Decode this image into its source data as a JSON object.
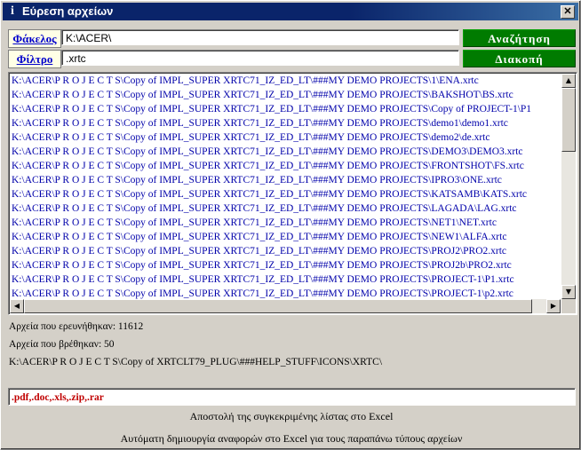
{
  "window": {
    "title": "Εύρεση αρχείων",
    "title_icon": "info-icon",
    "close_glyph": "✕"
  },
  "folder": {
    "label": "Φάκελος",
    "value": "K:\\ACER\\"
  },
  "filter": {
    "label": "Φίλτρο",
    "value": ".xrtc"
  },
  "buttons": {
    "search": "Αναζήτηση",
    "stop": "Διακοπή"
  },
  "results": [
    "K:\\ACER\\P R O J E C T S\\Copy of IMPL_SUPER XRTC71_IZ_ED_LT\\###MY DEMO PROJECTS\\1\\ENA.xrtc",
    "K:\\ACER\\P R O J E C T S\\Copy of IMPL_SUPER XRTC71_IZ_ED_LT\\###MY DEMO PROJECTS\\BAKSHOT\\BS.xrtc",
    "K:\\ACER\\P R O J E C T S\\Copy of IMPL_SUPER XRTC71_IZ_ED_LT\\###MY DEMO PROJECTS\\Copy of PROJECT-1\\P1",
    "K:\\ACER\\P R O J E C T S\\Copy of IMPL_SUPER XRTC71_IZ_ED_LT\\###MY DEMO PROJECTS\\demo1\\demo1.xrtc",
    "K:\\ACER\\P R O J E C T S\\Copy of IMPL_SUPER XRTC71_IZ_ED_LT\\###MY DEMO PROJECTS\\demo2\\de.xrtc",
    "K:\\ACER\\P R O J E C T S\\Copy of IMPL_SUPER XRTC71_IZ_ED_LT\\###MY DEMO PROJECTS\\DEMO3\\DEMO3.xrtc",
    "K:\\ACER\\P R O J E C T S\\Copy of IMPL_SUPER XRTC71_IZ_ED_LT\\###MY DEMO PROJECTS\\FRONTSHOT\\FS.xrtc",
    "K:\\ACER\\P R O J E C T S\\Copy of IMPL_SUPER XRTC71_IZ_ED_LT\\###MY DEMO PROJECTS\\IPRO3\\ONE.xrtc",
    "K:\\ACER\\P R O J E C T S\\Copy of IMPL_SUPER XRTC71_IZ_ED_LT\\###MY DEMO PROJECTS\\KATSAMB\\KATS.xrtc",
    "K:\\ACER\\P R O J E C T S\\Copy of IMPL_SUPER XRTC71_IZ_ED_LT\\###MY DEMO PROJECTS\\LAGADA\\LAG.xrtc",
    "K:\\ACER\\P R O J E C T S\\Copy of IMPL_SUPER XRTC71_IZ_ED_LT\\###MY DEMO PROJECTS\\NET1\\NET.xrtc",
    "K:\\ACER\\P R O J E C T S\\Copy of IMPL_SUPER XRTC71_IZ_ED_LT\\###MY DEMO PROJECTS\\NEW1\\ALFA.xrtc",
    "K:\\ACER\\P R O J E C T S\\Copy of IMPL_SUPER XRTC71_IZ_ED_LT\\###MY DEMO PROJECTS\\PROJ2\\PRO2.xrtc",
    "K:\\ACER\\P R O J E C T S\\Copy of IMPL_SUPER XRTC71_IZ_ED_LT\\###MY DEMO PROJECTS\\PROJ2b\\PRO2.xrtc",
    "K:\\ACER\\P R O J E C T S\\Copy of IMPL_SUPER XRTC71_IZ_ED_LT\\###MY DEMO PROJECTS\\PROJECT-1\\P1.xrtc",
    "K:\\ACER\\P R O J E C T S\\Copy of IMPL_SUPER XRTC71_IZ_ED_LT\\###MY DEMO PROJECTS\\PROJECT-1\\p2.xrtc"
  ],
  "status": {
    "searched": "Αρχεία που ερευνήθηκαν: 11612",
    "found": "Αρχεία που βρέθηκαν: 50",
    "current_path": "K:\\ACER\\P R O J E C T S\\Copy of XRTCLT79_PLUG\\###HELP_STUFF\\ICONS\\XRTC\\"
  },
  "extensions": ".pdf,.doc,.xls,.zip,.rar",
  "actions": {
    "send_list": "Αποστολή της συγκεκριμένης λίστας στο Excel",
    "auto_report": "Αυτόματη δημιουργία αναφορών στο Excel για τους παραπάνω τύπους αρχείων"
  },
  "scrollbars": {
    "up": "▲",
    "down": "▼",
    "left": "◀",
    "right": "▶"
  },
  "colors": {
    "title_bar": "#0a246a",
    "button_green": "#007b00",
    "list_text": "#0000aa",
    "extensions_text": "#c00000"
  }
}
